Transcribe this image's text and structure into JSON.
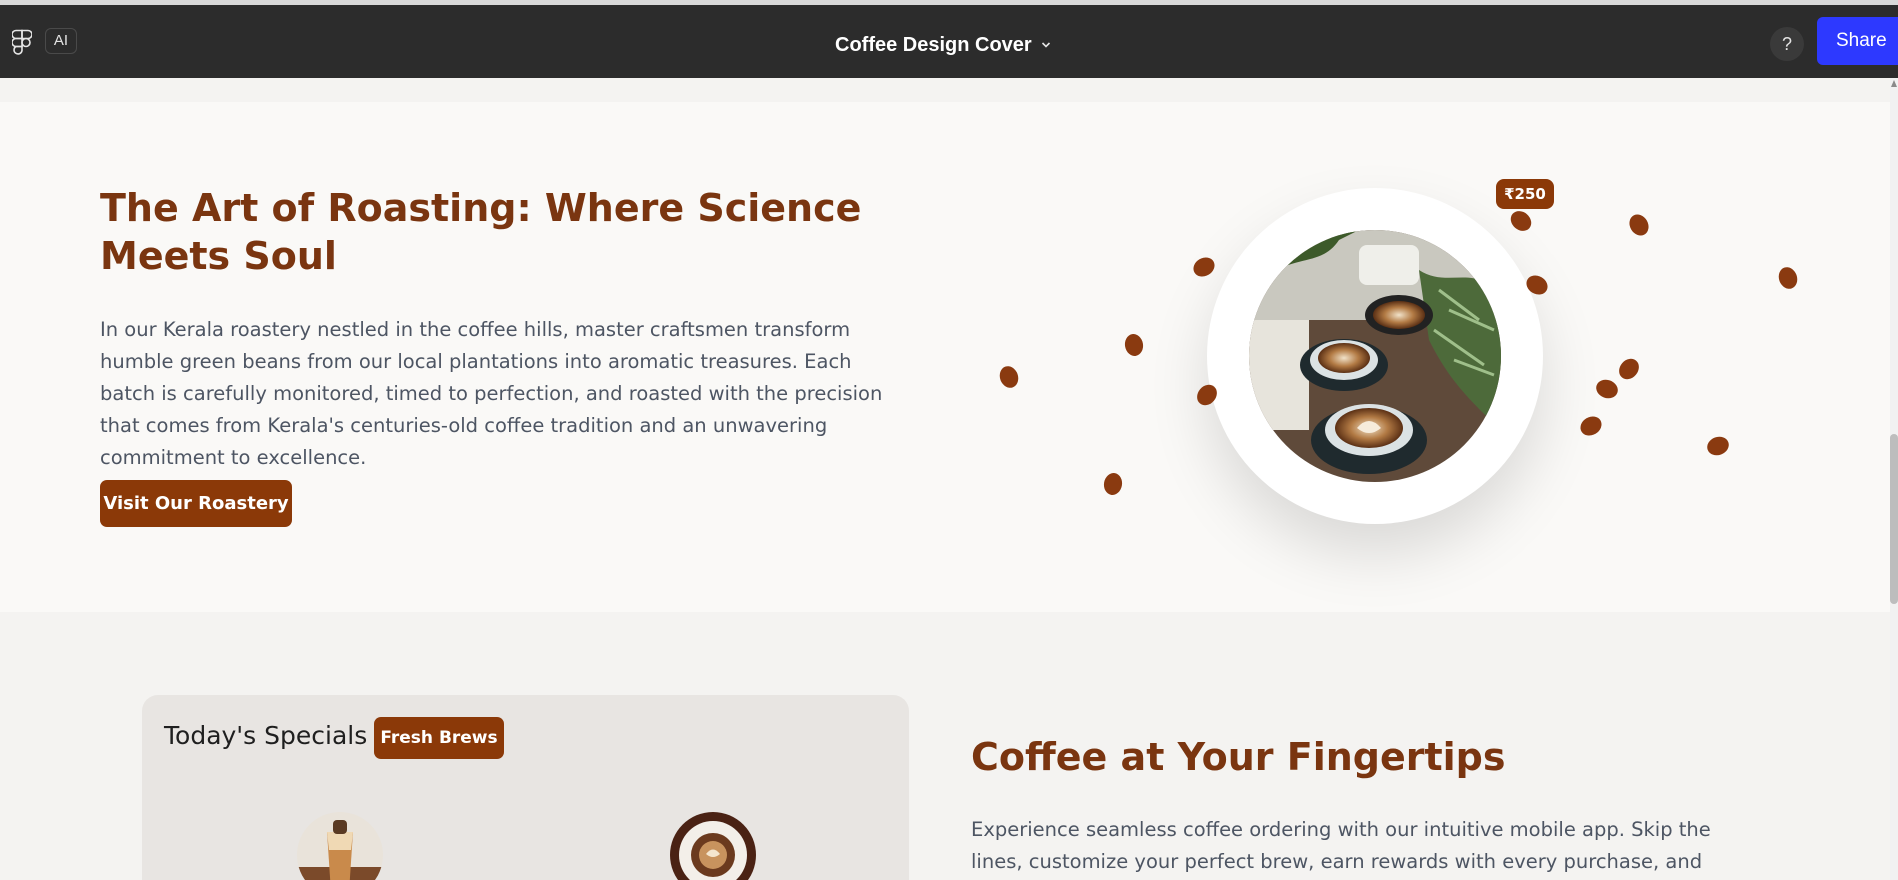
{
  "toolbar": {
    "ai_label": "AI",
    "doc_title": "Coffee Design Cover",
    "help_label": "?",
    "share_label": "Share"
  },
  "roast": {
    "title": "The Art of Roasting: Where Science Meets Soul",
    "body": "In our Kerala roastery nestled in the coffee hills, master craftsmen transform humble green beans from our local plantations into aromatic treasures. Each batch is carefully monitored, timed to perfection, and roasted with the precision that comes from Kerala's centuries-old coffee tradition and an unwavering commitment to excellence.",
    "cta_label": "Visit Our Roastery",
    "price_tag": "₹250"
  },
  "specials": {
    "title": "Today's Specials",
    "badge": "Fresh Brews"
  },
  "app": {
    "title": "Coffee at Your Fingertips",
    "body": "Experience seamless coffee ordering with our intuitive mobile app. Skip the lines, customize your perfect brew, earn rewards with every purchase, and enjoy priority"
  },
  "colors": {
    "brand_brown": "#8b3908",
    "heading_brown": "#7a3510",
    "share_blue": "#2d39ff",
    "toolbar_bg": "#2c2c2c"
  },
  "icons": [
    "figma-logo-icon",
    "chevron-down-icon",
    "help-icon"
  ]
}
